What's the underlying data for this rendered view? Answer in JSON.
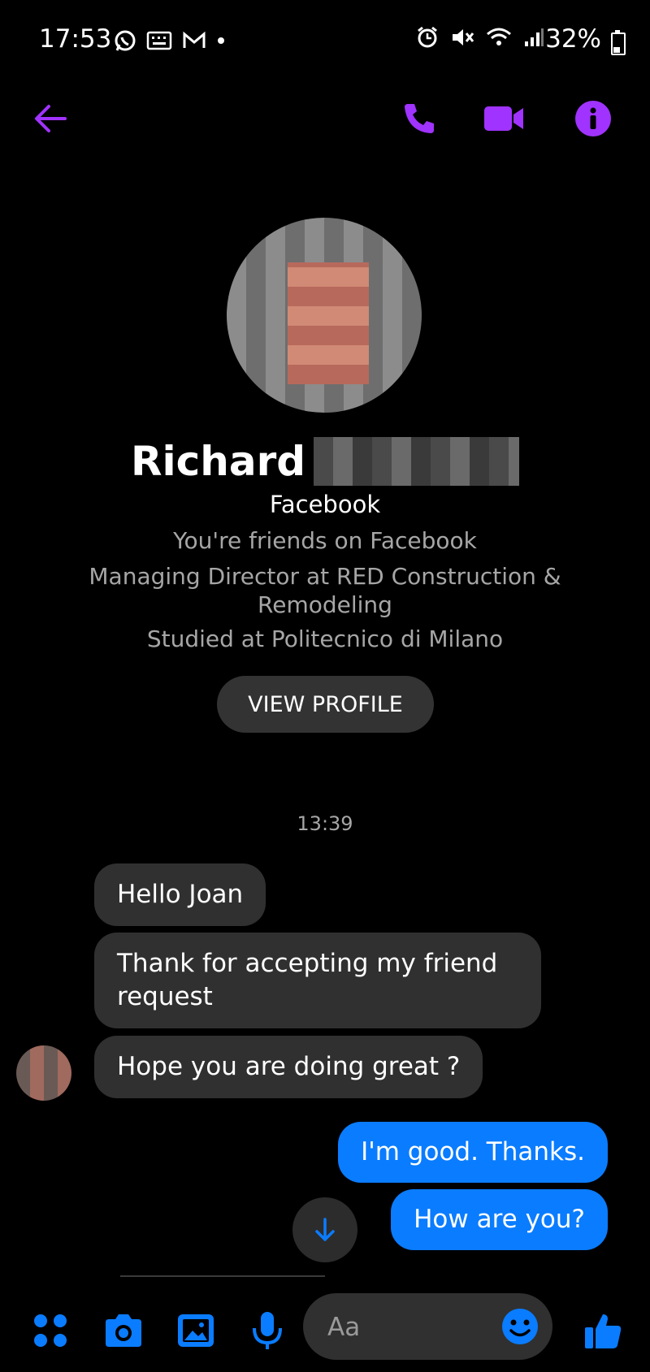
{
  "status_bar": {
    "time": "17:53",
    "battery": "32%",
    "left_icons": [
      "whatsapp-icon",
      "keyboard-icon",
      "gmail-icon",
      "dot-icon"
    ],
    "right_icons": [
      "alarm-icon",
      "mute-icon",
      "wifi-icon",
      "signal-icon",
      "battery-icon"
    ]
  },
  "header": {
    "icons": [
      "back-arrow-icon",
      "phone-call-icon",
      "video-call-icon",
      "info-icon"
    ],
    "accent_color": "#a033ff"
  },
  "profile": {
    "name": "Richard",
    "platform": "Facebook",
    "friendship": "You're friends on Facebook",
    "work_line1": "Managing Director at RED Construction &",
    "work_line2": "Remodeling",
    "education": "Studied at Politecnico di Milano",
    "view_profile_label": "VIEW PROFILE"
  },
  "conversation": {
    "timestamp": "13:39",
    "incoming": [
      {
        "text": "Hello Joan"
      },
      {
        "text": "Thank for accepting my friend request"
      },
      {
        "text": "Hope you are doing great ?"
      }
    ],
    "outgoing": [
      {
        "text": "I'm good. Thanks."
      },
      {
        "text": "How are you?"
      }
    ],
    "incoming_bubble_color": "#303030",
    "outgoing_bubble_color": "#0a7cff"
  },
  "composer": {
    "placeholder": "Aa",
    "icons": [
      "menu-dots-icon",
      "camera-icon",
      "gallery-icon",
      "microphone-icon",
      "emoji-icon",
      "thumbs-up-icon"
    ],
    "accent_color": "#0a7cff"
  }
}
